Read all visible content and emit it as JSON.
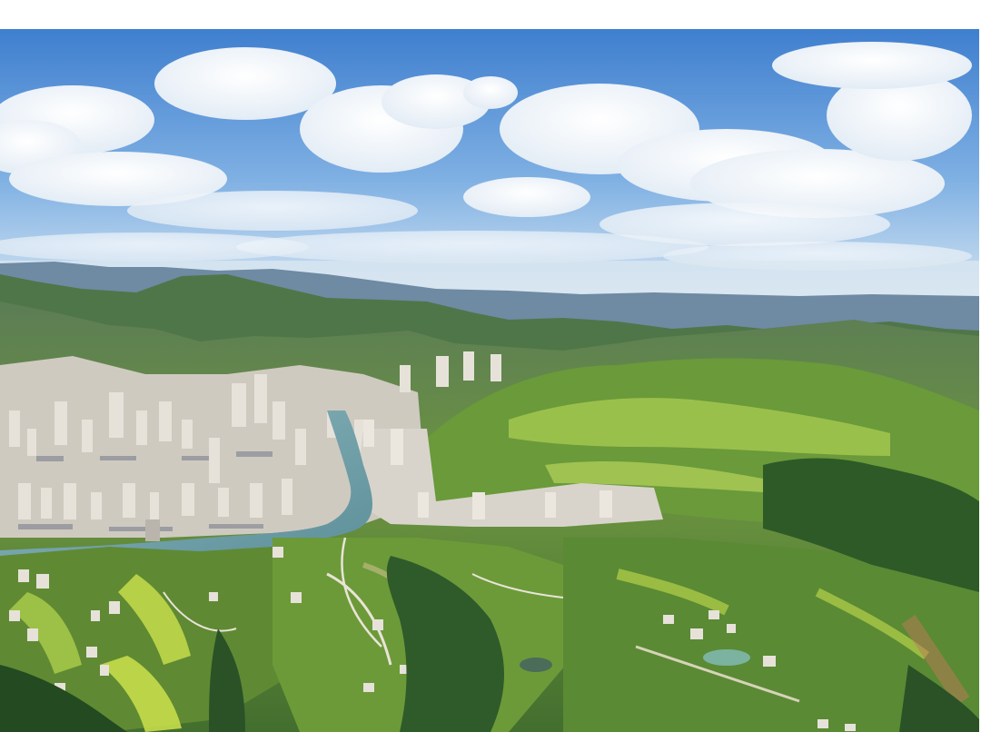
{
  "image": {
    "subject": "aerial-landscape",
    "colors": {
      "sky_top": "#3f7fcf",
      "sky_mid": "#7fb0e3",
      "haze": "#cfe0ee",
      "distant_mountains": "#6f8aa3",
      "mid_hills": "#4e7a4a",
      "near_hills": "#5f8f3a",
      "terraces": "#9cc24a",
      "forest": "#2f5a2a",
      "river": "#6f9fa8",
      "buildings": "#d9d6cf",
      "roofs": "#8c8f99"
    }
  }
}
